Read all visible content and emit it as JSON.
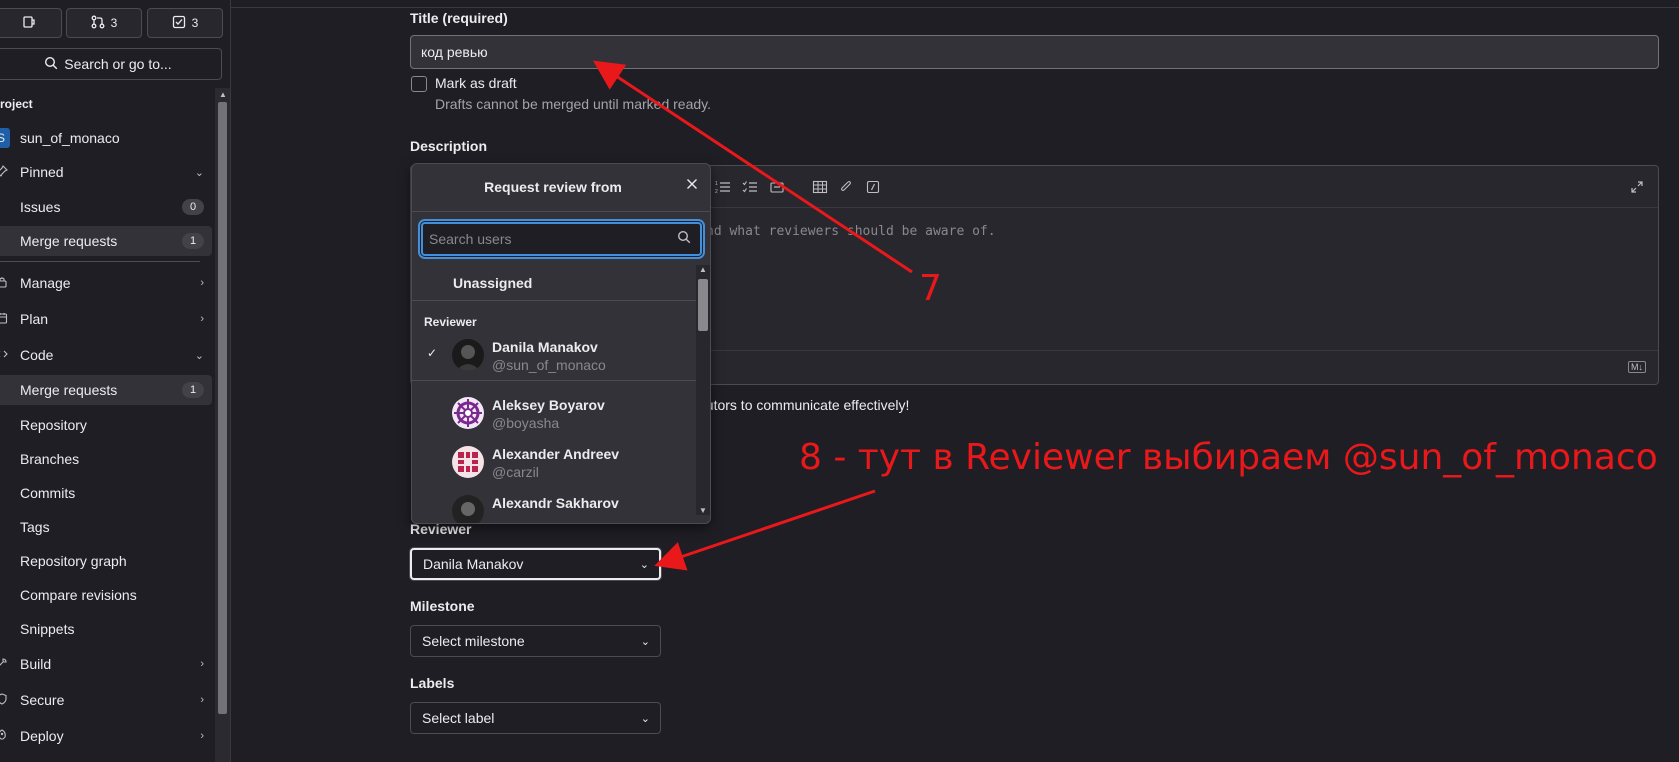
{
  "sidebar": {
    "top_buttons": [
      {
        "icon": "issues-icon",
        "count": ""
      },
      {
        "icon": "merge-request-icon",
        "count": "3"
      },
      {
        "icon": "todo-icon",
        "count": "3"
      }
    ],
    "search_label": "Search or go to...",
    "section_label": "roject",
    "project_initial": "S",
    "project_name": "sun_of_monaco",
    "items": [
      {
        "label": "Pinned",
        "icon": "pin-icon",
        "chevron": "down"
      },
      {
        "label": "Issues",
        "count": "0"
      },
      {
        "label": "Merge requests",
        "count": "1"
      },
      {
        "label": "Manage",
        "icon": "manage-icon",
        "chevron": "right"
      },
      {
        "label": "Plan",
        "icon": "plan-icon",
        "chevron": "right"
      },
      {
        "label": "Code",
        "icon": "code-icon",
        "chevron": "down"
      },
      {
        "label": "Merge requests",
        "count": "1"
      },
      {
        "label": "Repository"
      },
      {
        "label": "Branches"
      },
      {
        "label": "Commits"
      },
      {
        "label": "Tags"
      },
      {
        "label": "Repository graph"
      },
      {
        "label": "Compare revisions"
      },
      {
        "label": "Snippets"
      },
      {
        "label": "Build",
        "icon": "build-icon",
        "chevron": "right"
      },
      {
        "label": "Secure",
        "icon": "shield-icon",
        "chevron": "right"
      },
      {
        "label": "Deploy",
        "icon": "rocket-icon",
        "chevron": "right"
      }
    ]
  },
  "form": {
    "title_label": "Title (required)",
    "title_value": "код ревью",
    "draft_label": "Mark as draft",
    "draft_help": "Drafts cannot be merged until marked ready.",
    "description_label": "Description",
    "description_placeholder": "nd what reviewers should be aware of.",
    "description_help": "butors to communicate effectively!",
    "reviewer_label": "Reviewer",
    "reviewer_value": "Danila Manakov",
    "milestone_label": "Milestone",
    "milestone_value": "Select milestone",
    "labels_label": "Labels",
    "labels_value": "Select label",
    "markdown_badge": "M↓"
  },
  "dropdown": {
    "title": "Request review from",
    "search_placeholder": "Search users",
    "unassigned": "Unassigned",
    "group_label": "Reviewer",
    "users": [
      {
        "name": "Danila Manakov",
        "handle": "@sun_of_monaco",
        "selected": true
      },
      {
        "name": "Aleksey Boyarov",
        "handle": "@boyasha",
        "selected": false
      },
      {
        "name": "Alexander Andreev",
        "handle": "@carzil",
        "selected": false
      },
      {
        "name": "Alexandr Sakharov",
        "handle": "",
        "selected": false
      }
    ]
  },
  "annotations": {
    "step7": "7",
    "step8": "8 - тут в Reviewer выбираем @sun_of_monaco",
    "color": "#e8181b"
  }
}
